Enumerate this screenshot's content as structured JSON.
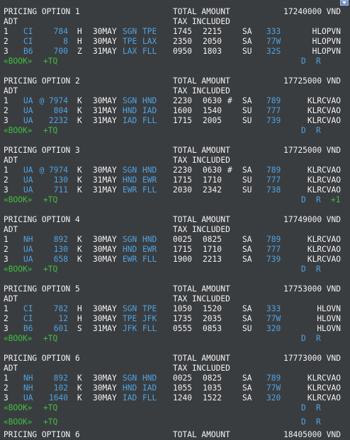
{
  "currency": "VND",
  "labels": {
    "pricing_option": "PRICING OPTION",
    "total_amount": "TOTAL AMOUNT",
    "adt": "ADT",
    "tax_included": "TAX INCLUDED",
    "book": "«BOOK»",
    "tq": "+TQ",
    "d": "D",
    "r": "R"
  },
  "options": [
    {
      "number": "1",
      "amount": "17240000 VND",
      "extra": "",
      "segments": [
        {
          "n": "1",
          "airline": "CI",
          "flight": "784",
          "cls": "H",
          "date": "30MAY",
          "from": "SGN",
          "to": "TPE",
          "dep": "1745",
          "arr": "2215",
          "plus": "",
          "days": "SA",
          "equip": "333",
          "fare": "HLOPVN"
        },
        {
          "n": "2",
          "airline": "CI",
          "flight": "8",
          "cls": "H",
          "date": "30MAY",
          "from": "TPE",
          "to": "LAX",
          "dep": "2350",
          "arr": "2050",
          "plus": "",
          "days": "SA",
          "equip": "77W",
          "fare": "HLOPVN"
        },
        {
          "n": "3",
          "airline": "B6",
          "flight": "700",
          "cls": "Z",
          "date": "31MAY",
          "from": "LAX",
          "to": "FLL",
          "dep": "0950",
          "arr": "1803",
          "plus": "",
          "days": "SU",
          "equip": "32S",
          "fare": "HLOPVN"
        }
      ]
    },
    {
      "number": "2",
      "amount": "17725000 VND",
      "extra": "",
      "segments": [
        {
          "n": "1",
          "airline": "UA",
          "flight": "@ 7974",
          "cls": "K",
          "date": "30MAY",
          "from": "SGN",
          "to": "HND",
          "dep": "2230",
          "arr": "0630",
          "plus": "#",
          "days": "SA",
          "equip": "789",
          "fare": "KLRCVAO"
        },
        {
          "n": "2",
          "airline": "UA",
          "flight": "804",
          "cls": "K",
          "date": "31MAY",
          "from": "HND",
          "to": "IAD",
          "dep": "1600",
          "arr": "1540",
          "plus": "",
          "days": "SU",
          "equip": "777",
          "fare": "KLRCVAO"
        },
        {
          "n": "3",
          "airline": "UA",
          "flight": "2232",
          "cls": "K",
          "date": "31MAY",
          "from": "IAD",
          "to": "FLL",
          "dep": "1715",
          "arr": "2005",
          "plus": "",
          "days": "SU",
          "equip": "739",
          "fare": "KLRCVAO"
        }
      ]
    },
    {
      "number": "3",
      "amount": "17725000 VND",
      "extra": "+1",
      "segments": [
        {
          "n": "1",
          "airline": "UA",
          "flight": "@ 7974",
          "cls": "K",
          "date": "30MAY",
          "from": "SGN",
          "to": "HND",
          "dep": "2230",
          "arr": "0630",
          "plus": "#",
          "days": "SA",
          "equip": "789",
          "fare": "KLRCVAO"
        },
        {
          "n": "2",
          "airline": "UA",
          "flight": "130",
          "cls": "K",
          "date": "31MAY",
          "from": "HND",
          "to": "EWR",
          "dep": "1715",
          "arr": "1710",
          "plus": "",
          "days": "SU",
          "equip": "777",
          "fare": "KLRCVAO"
        },
        {
          "n": "3",
          "airline": "UA",
          "flight": "711",
          "cls": "K",
          "date": "31MAY",
          "from": "EWR",
          "to": "FLL",
          "dep": "2030",
          "arr": "2342",
          "plus": "",
          "days": "SU",
          "equip": "738",
          "fare": "KLRCVAO"
        }
      ]
    },
    {
      "number": "4",
      "amount": "17749000 VND",
      "extra": "",
      "segments": [
        {
          "n": "1",
          "airline": "NH",
          "flight": "892",
          "cls": "K",
          "date": "30MAY",
          "from": "SGN",
          "to": "HND",
          "dep": "0025",
          "arr": "0825",
          "plus": "",
          "days": "SA",
          "equip": "789",
          "fare": "KLRCVAO"
        },
        {
          "n": "2",
          "airline": "UA",
          "flight": "130",
          "cls": "K",
          "date": "30MAY",
          "from": "HND",
          "to": "EWR",
          "dep": "1715",
          "arr": "1710",
          "plus": "",
          "days": "SA",
          "equip": "777",
          "fare": "KLRCVAO"
        },
        {
          "n": "3",
          "airline": "UA",
          "flight": "658",
          "cls": "K",
          "date": "30MAY",
          "from": "EWR",
          "to": "FLL",
          "dep": "1900",
          "arr": "2213",
          "plus": "",
          "days": "SA",
          "equip": "739",
          "fare": "KLRCVAO"
        }
      ]
    },
    {
      "number": "5",
      "amount": "17753000 VND",
      "extra": "",
      "segments": [
        {
          "n": "1",
          "airline": "CI",
          "flight": "782",
          "cls": "H",
          "date": "30MAY",
          "from": "SGN",
          "to": "TPE",
          "dep": "1050",
          "arr": "1520",
          "plus": "",
          "days": "SA",
          "equip": "333",
          "fare": "HLOVN"
        },
        {
          "n": "2",
          "airline": "CI",
          "flight": "12",
          "cls": "H",
          "date": "30MAY",
          "from": "TPE",
          "to": "JFK",
          "dep": "1735",
          "arr": "2035",
          "plus": "",
          "days": "SA",
          "equip": "77W",
          "fare": "HLOVN"
        },
        {
          "n": "3",
          "airline": "B6",
          "flight": "601",
          "cls": "S",
          "date": "31MAY",
          "from": "JFK",
          "to": "FLL",
          "dep": "0555",
          "arr": "0853",
          "plus": "",
          "days": "SU",
          "equip": "320",
          "fare": "HLOVN"
        }
      ]
    },
    {
      "number": "6",
      "amount": "17773000 VND",
      "extra": "",
      "segments": [
        {
          "n": "1",
          "airline": "NH",
          "flight": "892",
          "cls": "K",
          "date": "30MAY",
          "from": "SGN",
          "to": "HND",
          "dep": "0025",
          "arr": "0825",
          "plus": "",
          "days": "SA",
          "equip": "789",
          "fare": "KLRCVAO"
        },
        {
          "n": "2",
          "airline": "NH",
          "flight": "102",
          "cls": "K",
          "date": "30MAY",
          "from": "HND",
          "to": "IAD",
          "dep": "1055",
          "arr": "1035",
          "plus": "",
          "days": "SA",
          "equip": "77W",
          "fare": "KLRCVAO"
        },
        {
          "n": "3",
          "airline": "UA",
          "flight": "1640",
          "cls": "K",
          "date": "30MAY",
          "from": "IAD",
          "to": "FLL",
          "dep": "1240",
          "arr": "1522",
          "plus": "",
          "days": "SA",
          "equip": "320",
          "fare": "KLRCVAO"
        }
      ]
    }
  ],
  "ghost_row": {
    "book": "«BOOK»",
    "tq": "+TQ",
    "d": "D",
    "r": "R"
  },
  "partial_row": {
    "pricing_option": "PRICING OPTION 6",
    "total_amount": "TOTAL AMOUNT",
    "amount": "18405000 VND"
  }
}
